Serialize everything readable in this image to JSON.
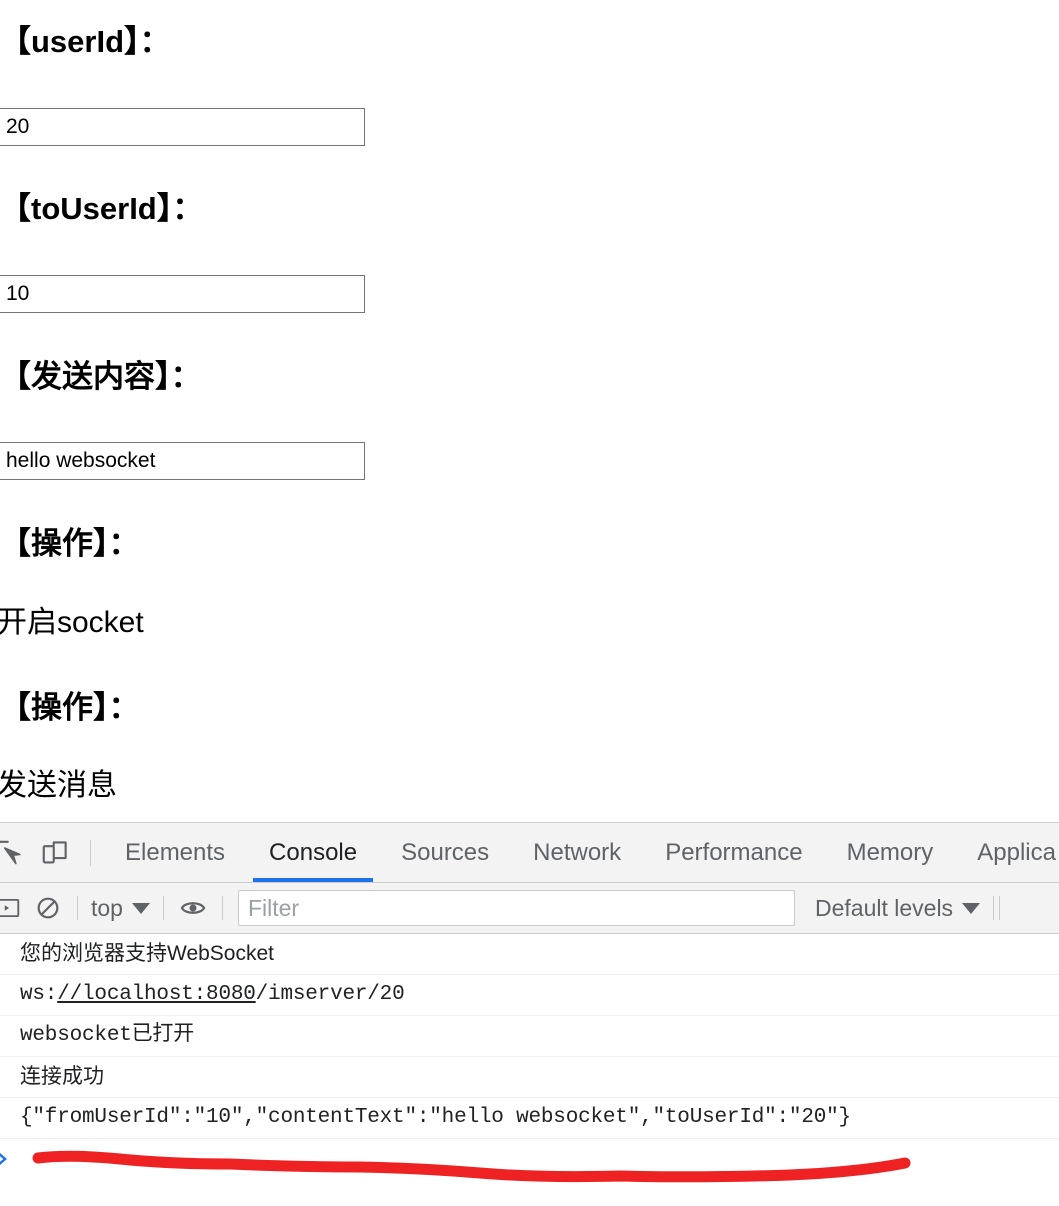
{
  "page": {
    "fields": [
      {
        "heading": "【userId】：",
        "value": "20",
        "name": "userid"
      },
      {
        "heading": "【toUserId】：",
        "value": "10",
        "name": "touserid"
      },
      {
        "heading": "【发送内容】：",
        "value": "hello websocket",
        "name": "content"
      }
    ],
    "operations": [
      {
        "heading": "【操作】：",
        "action": "开启socket",
        "name": "open-socket"
      },
      {
        "heading": "【操作】：",
        "action": "发送消息",
        "name": "send-message"
      }
    ]
  },
  "devtools": {
    "icons": {
      "inspect": "inspect-element-icon",
      "device": "device-toolbar-icon",
      "console_sidebar": "console-sidebar-icon",
      "clear_console": "clear-console-icon",
      "eye": "live-expression-eye-icon"
    },
    "tabs": [
      {
        "label": "Elements",
        "active": false
      },
      {
        "label": "Console",
        "active": true
      },
      {
        "label": "Sources",
        "active": false
      },
      {
        "label": "Network",
        "active": false
      },
      {
        "label": "Performance",
        "active": false
      },
      {
        "label": "Memory",
        "active": false
      },
      {
        "label": "Applica",
        "active": false
      }
    ],
    "active_tab_accent": "#1a73e8",
    "toolbar": {
      "context_selector": "top",
      "filter_placeholder": "Filter",
      "filter_value": "",
      "levels_selector": "Default levels"
    },
    "console_messages": [
      {
        "text": "您的浏览器支持WebSocket",
        "mono": false,
        "link": ""
      },
      {
        "text": "ws://localhost:8080/imserver/20",
        "mono": true,
        "link": "//localhost:8080",
        "prefix": "ws:",
        "suffix": "/imserver/20"
      },
      {
        "text": "websocket已打开",
        "mono": true,
        "link": ""
      },
      {
        "text": "连接成功",
        "mono": false,
        "link": ""
      },
      {
        "text": "{\"fromUserId\":\"10\",\"contentText\":\"hello websocket\",\"toUserId\":\"20\"}",
        "mono": true,
        "link": ""
      }
    ],
    "prompt_symbol": "›"
  },
  "annotation": {
    "color": "#ee2222",
    "type": "hand-drawn-underline"
  }
}
